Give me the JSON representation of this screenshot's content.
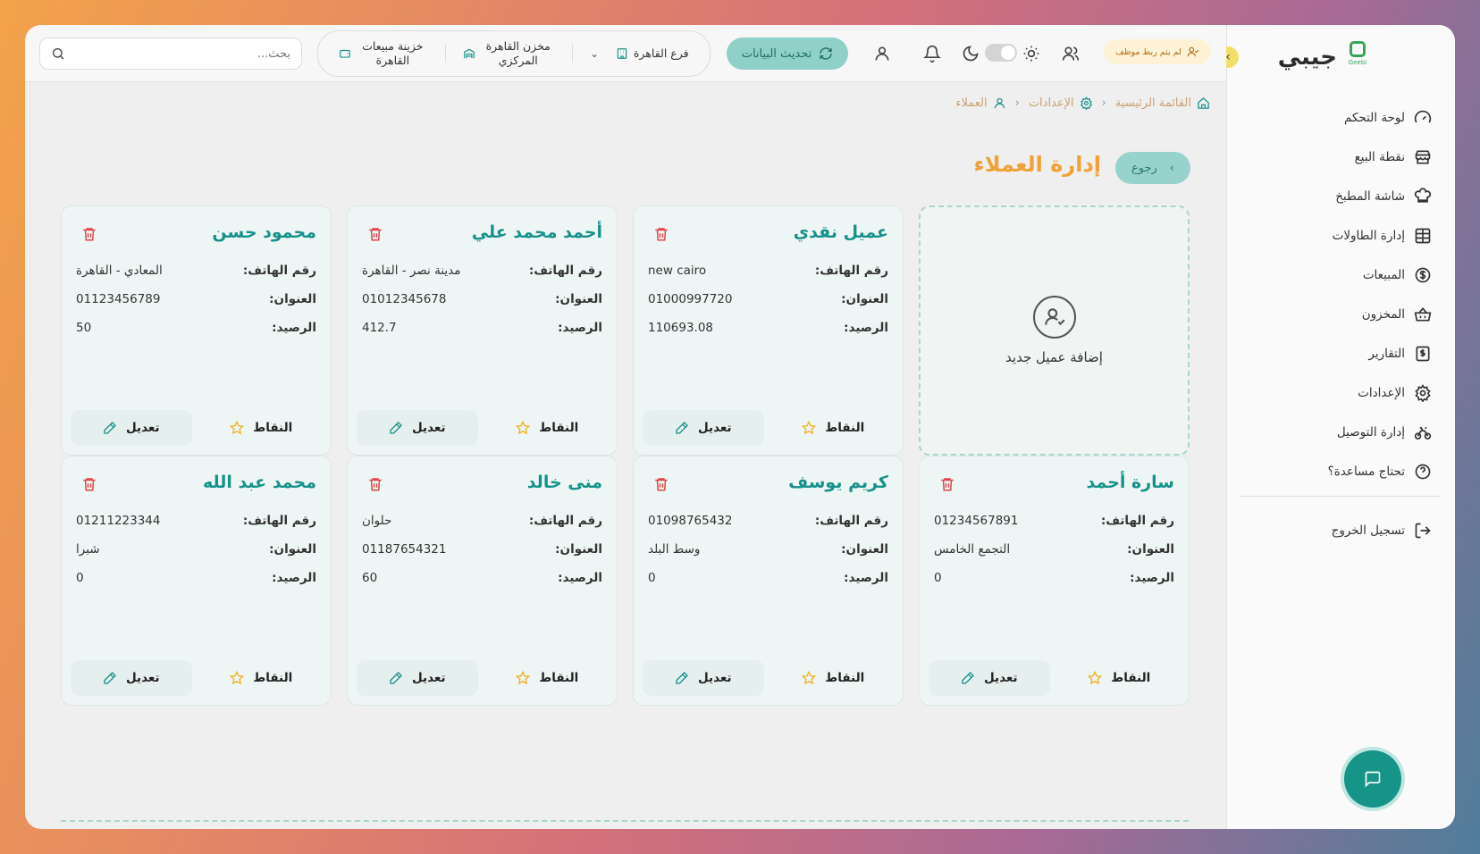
{
  "brand": {
    "name": "جيبي",
    "logo_text": "Geebi"
  },
  "sidebar": {
    "items": [
      {
        "label": "لوحة التحكم",
        "icon": "gauge-icon"
      },
      {
        "label": "نقطة البيع",
        "icon": "store-icon"
      },
      {
        "label": "شاشة المطبخ",
        "icon": "chef-hat-icon"
      },
      {
        "label": "إدارة الطاولات",
        "icon": "table-grid-icon"
      },
      {
        "label": "المبيعات",
        "icon": "dollar-circle-icon"
      },
      {
        "label": "المخزون",
        "icon": "basket-icon"
      },
      {
        "label": "التقارير",
        "icon": "report-icon"
      },
      {
        "label": "الإعدادات",
        "icon": "gear-icon"
      },
      {
        "label": "إدارة التوصيل",
        "icon": "bike-icon"
      },
      {
        "label": "تحتاج مساعدة؟",
        "icon": "help-icon"
      }
    ],
    "logout": "تسجيل الخروج"
  },
  "topbar": {
    "search_placeholder": "بحث...",
    "treasury": "خزينة مبيعات القاهرة",
    "warehouse": "مخزن القاهرة المركزي",
    "branch": "فرع القاهرة",
    "refresh": "تحديث البيانات",
    "staff_badge": "لم يتم ربط موظف"
  },
  "breadcrumb": {
    "home": "القائمة الرئيسية",
    "settings": "الإعدادات",
    "current": "العملاء"
  },
  "page": {
    "title": "إدارة العملاء",
    "back": "رجوع",
    "add_customer": "إضافة عميل جديد"
  },
  "labels": {
    "phone": "رقم الهاتف:",
    "address": "العنوان:",
    "balance": "الرصيد:",
    "points": "النقاط",
    "edit": "تعديل"
  },
  "customers": [
    {
      "name": "عميل نقدي",
      "phone": "new cairo",
      "address": "01000997720",
      "balance": "110693.08"
    },
    {
      "name": "أحمد محمد علي",
      "phone": "مدينة نصر - القاهرة",
      "address": "01012345678",
      "balance": "412.7"
    },
    {
      "name": "محمود حسن",
      "phone": "المعادي - القاهرة",
      "address": "01123456789",
      "balance": "50"
    },
    {
      "name": "سارة أحمد",
      "phone": "01234567891",
      "address": "التجمع الخامس",
      "balance": "0"
    },
    {
      "name": "كريم يوسف",
      "phone": "01098765432",
      "address": "وسط البلد",
      "balance": "0"
    },
    {
      "name": "منى خالد",
      "phone": "حلوان",
      "address": "01187654321",
      "balance": "60"
    },
    {
      "name": "محمد عبد الله",
      "phone": "01211223344",
      "address": "شبرا",
      "balance": "0"
    }
  ],
  "colors": {
    "accent": "#17928a",
    "title": "#f0a236",
    "danger": "#e0454a",
    "star": "#f2b01e"
  }
}
